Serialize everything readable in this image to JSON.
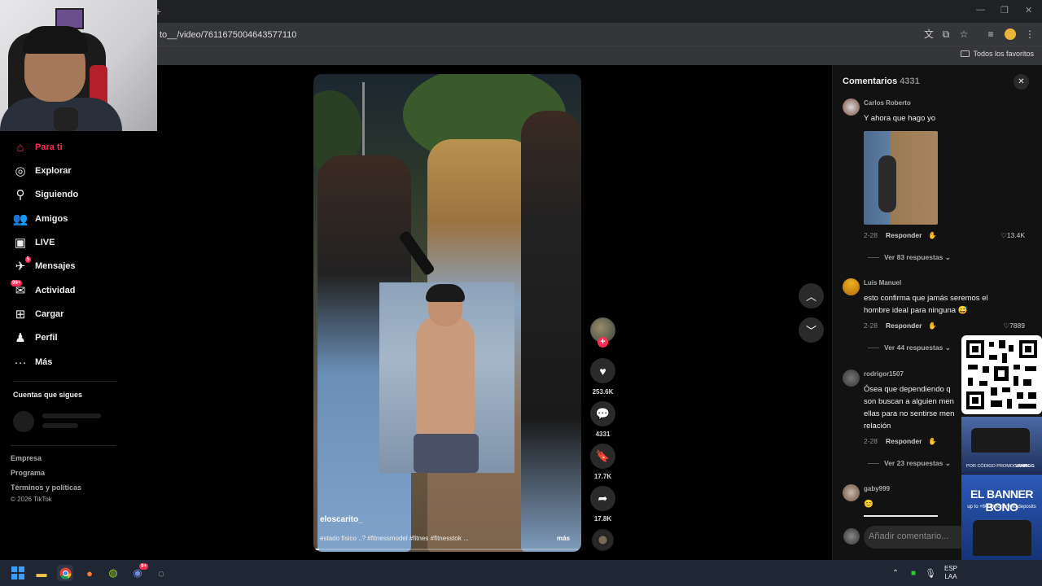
{
  "browser": {
    "url": "to__/video/7611675004643577110",
    "favorites_label": "Todos los favoritos",
    "new_tab": "+"
  },
  "nav": {
    "items": [
      {
        "label": "Para ti",
        "icon": "home-icon"
      },
      {
        "label": "Explorar",
        "icon": "compass-icon"
      },
      {
        "label": "Siguiendo",
        "icon": "following-icon"
      },
      {
        "label": "Amigos",
        "icon": "friends-icon"
      },
      {
        "label": "LIVE",
        "icon": "live-icon"
      },
      {
        "label": "Mensajes",
        "icon": "messages-icon",
        "badge": "5"
      },
      {
        "label": "Actividad",
        "icon": "activity-icon",
        "badge": "99+"
      },
      {
        "label": "Cargar",
        "icon": "upload-icon"
      },
      {
        "label": "Perfil",
        "icon": "profile-icon"
      },
      {
        "label": "Más",
        "icon": "more-icon"
      }
    ],
    "following_title": "Cuentas que sigues",
    "footer": [
      "Empresa",
      "Programa",
      "Términos y políticas"
    ],
    "copyright": "© 2026 TikTok"
  },
  "video": {
    "username": "eloscarito_",
    "description": "estado físico ..? #fitnessmodel #fitnes #fitnesstok ...",
    "more": "más",
    "progress_fraction": 0.02
  },
  "actions": {
    "likes": "253.6K",
    "comments": "4331",
    "saves": "17.7K",
    "shares": "17.8K"
  },
  "comments": {
    "title": "Comentarios",
    "count": "4331",
    "add_placeholder": "Añadir comentario...",
    "items": [
      {
        "user": "Carlos Roberto",
        "text": "Y ahora que hago yo",
        "date": "2-28",
        "reply": "Responder",
        "likes": "13.4K",
        "replies": "Ver 83 respuestas"
      },
      {
        "user": "Luis Manuel",
        "text": "esto confirma que jamás seremos el hombre ideal para ninguna 😅",
        "date": "2-28",
        "reply": "Responder",
        "likes": "7889",
        "replies": "Ver 44 respuestas"
      },
      {
        "user": "rodrigor1507",
        "text": "Ósea que dependiendo q son buscan a alguien men ellas para no sentirse men relación",
        "date": "2-28",
        "reply": "Responder",
        "replies": "Ver 23 respuestas"
      },
      {
        "user": "gaby999",
        "text": "😊"
      }
    ]
  },
  "ad": {
    "title": "EL BANNER BONO",
    "subtitle": "up to +600% for crypto deposits",
    "brand": "VANNGG",
    "promo": "POR CÓDIGO PROMOCIONAL"
  },
  "taskbar": {
    "lang1": "ESP",
    "lang2": "LAA",
    "discord_badge": "9+"
  },
  "colors": {
    "accent": "#fe2c55",
    "panel": "#121212"
  }
}
